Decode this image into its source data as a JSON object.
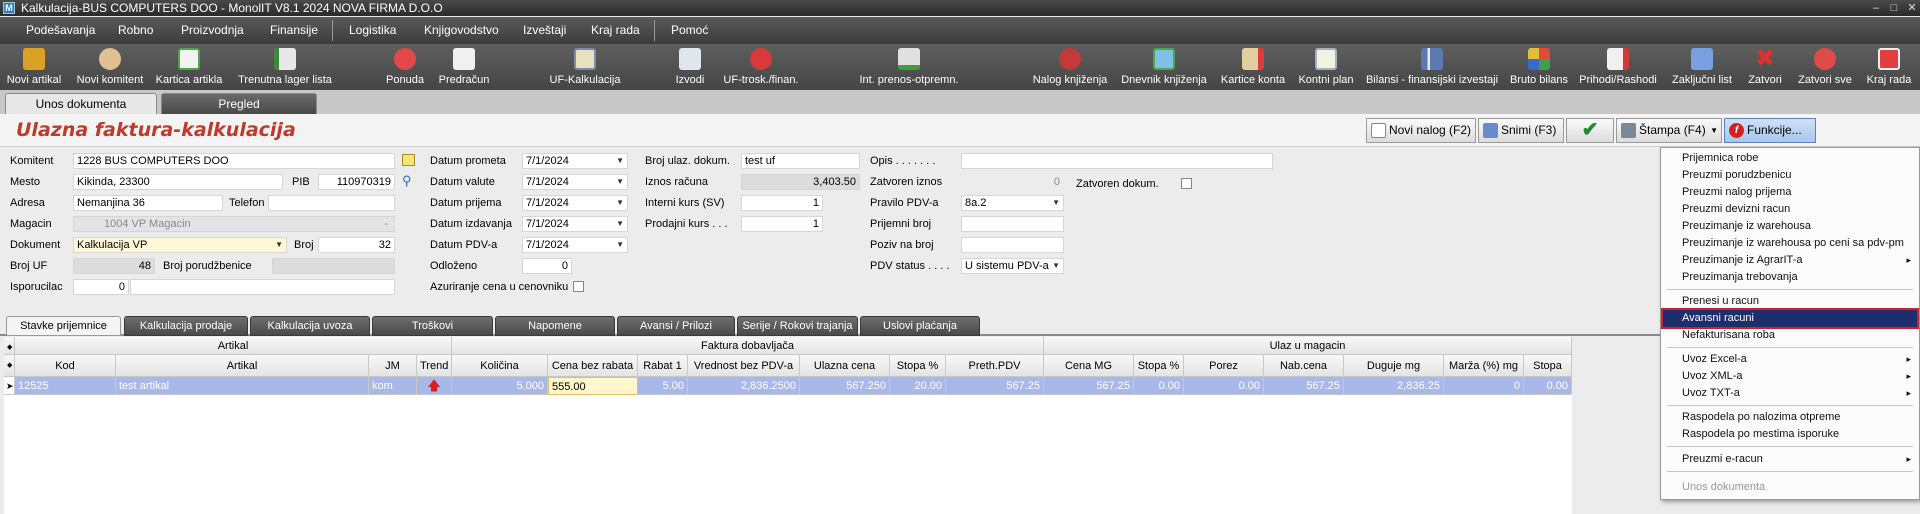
{
  "window": {
    "title": "Kalkulacija-BUS COMPUTERS DOO - MonolIT V8.1 2024 NOVA FIRMA D.O.O",
    "app_icon": "M"
  },
  "menu": [
    "Podešavanja",
    "Robno",
    "Proizvodnja",
    "Finansije",
    "Logistika",
    "Knjigovodstvo",
    "Izveštaji",
    "Kraj rada",
    "Pomoć"
  ],
  "toolbar": [
    "Novi artikal",
    "Novi komitent",
    "Kartica artikla",
    "Trenutna lager lista",
    "Ponuda",
    "Predračun",
    "UF-Kalkulacija",
    "Izvodi",
    "UF-trosk./finan.",
    "Int. prenos-otpremn.",
    "Nalog knjiženja",
    "Dnevnik knjiženja",
    "Kartice konta",
    "Kontni plan",
    "Bilansi - finansijski izvestaji",
    "Bruto bilans",
    "Prihodi/Rashodi",
    "Zaključni list",
    "Zatvori",
    "Zatvori sve",
    "Kraj rada"
  ],
  "doc_tabs": [
    "Unos dokumenta",
    "Pregled"
  ],
  "page_title": "Ulazna faktura-kalkulacija",
  "actions": {
    "new": "Novi nalog (F2)",
    "save": "Snimi (F3)",
    "print": "Štampa (F4)",
    "func": "Funkcije..."
  },
  "form": {
    "komitent_label": "Komitent",
    "komitent": "1228 BUS COMPUTERS DOO",
    "mesto_label": "Mesto",
    "mesto": "Kikinda, 23300",
    "pib_label": "PIB",
    "pib": "110970319",
    "adresa_label": "Adresa",
    "adresa": "Nemanjina 36",
    "telefon_label": "Telefon",
    "telefon": "",
    "magacin_label": "Magacin",
    "magacin": "1004 VP Magacin",
    "magacin_dash": "-",
    "dokument_label": "Dokument",
    "dokument": "Kalkulacija VP",
    "broj_label": "Broj",
    "broj": "32",
    "brojuf_label": "Broj UF",
    "brojuf": "48",
    "brojpor_label": "Broj porudžbenice",
    "brojpor": "",
    "isporucilac_label": "Isporucilac",
    "isporucilac": "0",
    "datum_prometa_label": "Datum prometa",
    "datum_prometa": "7/1/2024",
    "datum_valute_label": "Datum valute",
    "datum_valute": "7/1/2024",
    "datum_prijema_label": "Datum prijema",
    "datum_prijema": "7/1/2024",
    "datum_izdavanja_label": "Datum izdavanja",
    "datum_izdavanja": "7/1/2024",
    "datum_pdv_label": "Datum PDV-a",
    "datum_pdv": "7/1/2024",
    "odlozeno_label": "Odloženo",
    "odlozeno": "0",
    "azuriranje_label": "Azuriranje cena u cenovniku",
    "broj_ulaz_label": "Broj ulaz. dokum.",
    "broj_ulaz": "test uf",
    "iznos_label": "Iznos računa",
    "iznos": "3,403.50",
    "interni_label": "Interni kurs (SV)",
    "interni": "1",
    "prodajni_label": "Prodajni kurs . . .",
    "prodajni": "1",
    "opis_label": "Opis . . . . . . .",
    "opis": "",
    "zatvoren_iznos_label": "Zatvoren iznos",
    "zatvoren_iznos": "0",
    "zatvoren_dok_label": "Zatvoren dokum.",
    "pravilo_label": "Pravilo PDV-a",
    "pravilo": "8a.2",
    "prijemni_label": "Prijemni broj",
    "prijemni": "",
    "poziv_label": "Poziv na broj",
    "poziv": "",
    "pdvstatus_label": "PDV status . . . .",
    "pdvstatus": "U sistemu PDV-a"
  },
  "sub_tabs": [
    "Stavke prijemnice",
    "Kalkulacija prodaje",
    "Kalkulacija uvoza",
    "Troškovi",
    "Napomene",
    "Avansi / Prilozi",
    "Serije / Rokovi trajanja",
    "Uslovi plaćanja"
  ],
  "grid": {
    "groups": [
      "Artikal",
      "Faktura dobavljača",
      "Ulaz u magacin"
    ],
    "columns": [
      "Kod",
      "Artikal",
      "JM",
      "Trend",
      "Količina",
      "Cena bez rabata",
      "Rabat 1",
      "Vrednost bez PDV-a",
      "Ulazna cena",
      "Stopa %",
      "Preth.PDV",
      "Cena MG",
      "Stopa %",
      "Porez",
      "Nab.cena",
      "Duguje mg",
      "Marža (%) mg",
      "Stopa"
    ],
    "rows": [
      [
        "12525",
        "test artikal",
        "kom",
        "",
        "5.000",
        "555.00",
        "5.00",
        "2,836.2500",
        "567.250",
        "20.00",
        "567.25",
        "567.25",
        "0.00",
        "0.00",
        "567.25",
        "2,836.25",
        "0",
        "0.00"
      ]
    ]
  },
  "context_menu": [
    {
      "label": "Prijemnica robe"
    },
    {
      "label": "Preuzmi porudzbenicu"
    },
    {
      "label": "Preuzmi nalog prijema"
    },
    {
      "label": "Preuzmi devizni racun"
    },
    {
      "label": "Preuzimanje iz warehousa"
    },
    {
      "label": "Preuzimanje iz warehousa po ceni sa pdv-pm"
    },
    {
      "label": "Preuzimanje iz AgrarIT-a",
      "sub": "▸"
    },
    {
      "label": "Preuzimanja trebovanja"
    },
    {
      "label": "Prenesi u racun"
    },
    {
      "label": "Avansni racuni"
    },
    {
      "label": "Nefakturisana roba"
    },
    {
      "label": "Uvoz Excel-a",
      "sub": "▸"
    },
    {
      "label": "Uvoz XML-a",
      "sub": "▸"
    },
    {
      "label": "Uvoz TXT-a",
      "sub": "▸"
    },
    {
      "label": "Raspodela po nalozima otpreme"
    },
    {
      "label": "Raspodela po mestima isporuke"
    },
    {
      "label": "Preuzmi e-racun",
      "sub": "▸"
    },
    {
      "label": "Unos dokumenta"
    }
  ],
  "colors": {
    "accent": "#c0392b",
    "highlight": "#1c2e6e",
    "selected_row": "#a8b8e8"
  }
}
